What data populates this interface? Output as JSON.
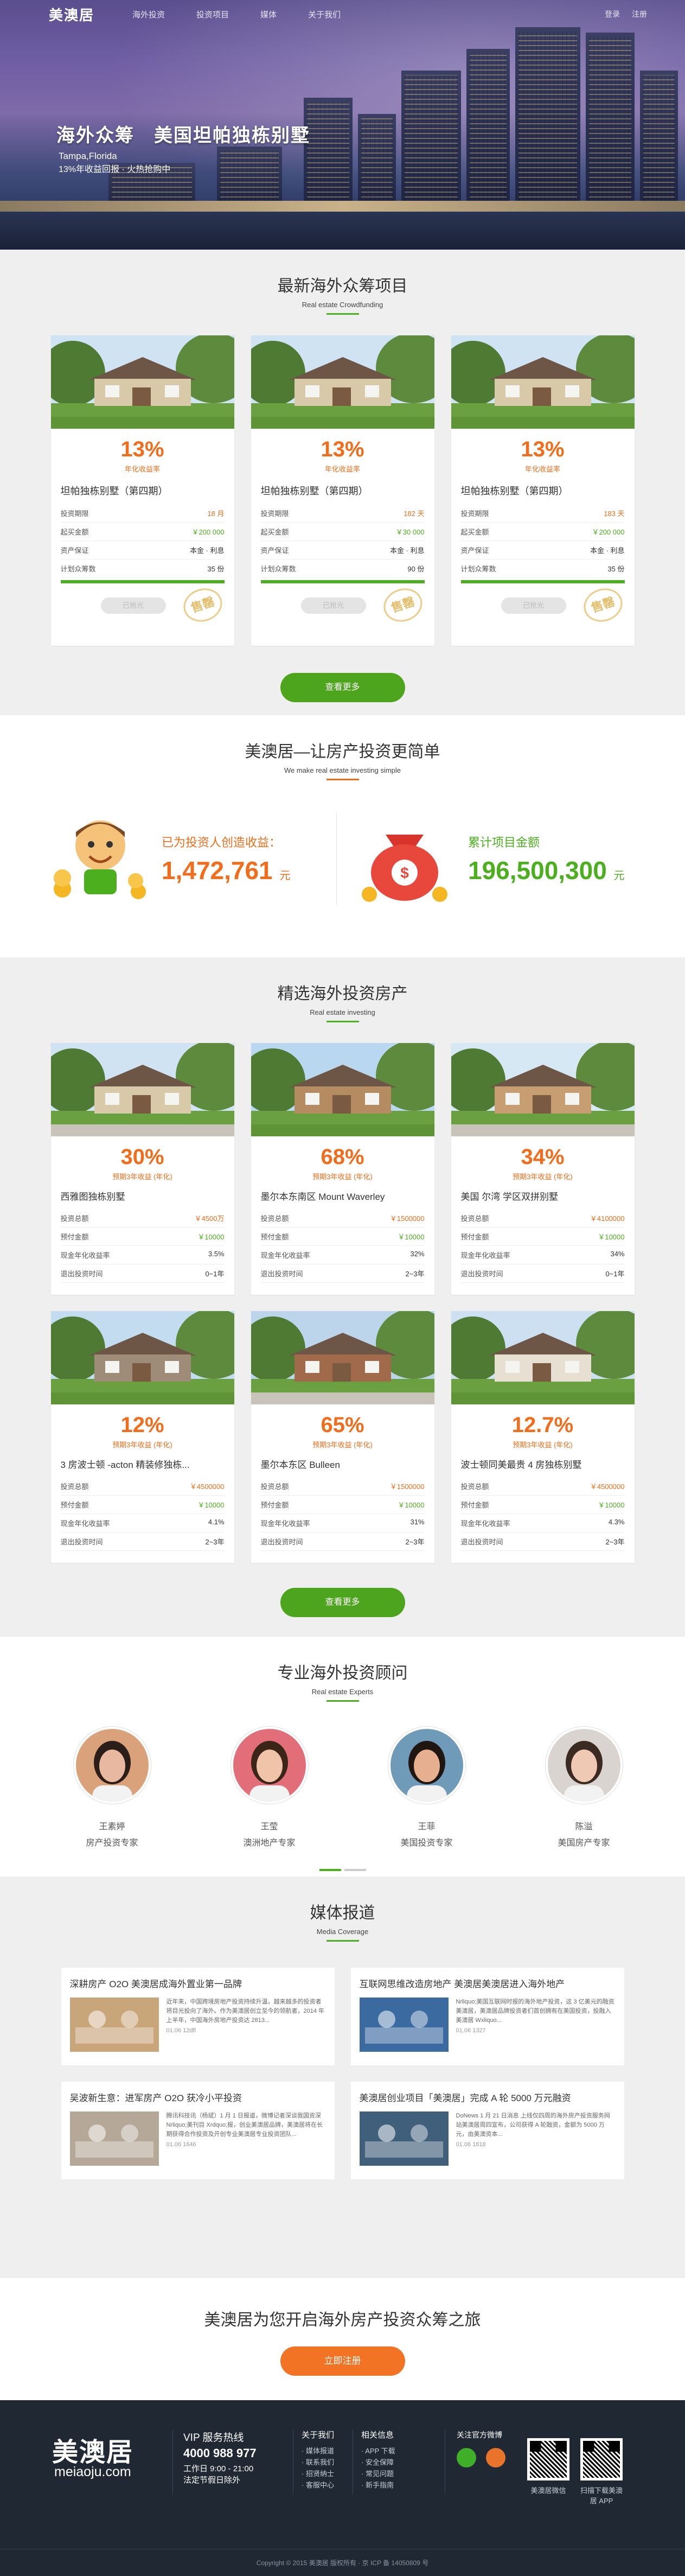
{
  "header": {
    "logo": "美澳居",
    "nav": [
      "海外投资",
      "投资项目",
      "媒体",
      "关于我们"
    ],
    "right_links": [
      "登录",
      "注册"
    ]
  },
  "hero": {
    "title": "海外众筹　美国坦帕独栋别墅",
    "location": "Tampa,Florida",
    "subtitle": "13%年收益回报 · 火热抢购中"
  },
  "crowdfunding": {
    "title": "最新海外众筹项目",
    "subtitle": "Real estate Crowdfunding",
    "more_label": "查看更多",
    "items": [
      {
        "pct": "13%",
        "pct_label": "年化收益率",
        "name": "坦帕独栋别墅（第四期）",
        "rows": [
          [
            "投资期限",
            "18 月"
          ],
          [
            "起买金额",
            "￥200 000"
          ],
          [
            "资产保证",
            "本金 · 利息"
          ],
          [
            "计划众筹数",
            "35 份"
          ]
        ],
        "button": "已抢光",
        "stamp": "售罄",
        "progress": 1.0
      },
      {
        "pct": "13%",
        "pct_label": "年化收益率",
        "name": "坦帕独栋别墅（第四期）",
        "rows": [
          [
            "投资期限",
            "182 天"
          ],
          [
            "起买金额",
            "￥30 000"
          ],
          [
            "资产保证",
            "本金 · 利息"
          ],
          [
            "计划众筹数",
            "90 份"
          ]
        ],
        "button": "已抢光",
        "stamp": "售罄",
        "progress": 1.0
      },
      {
        "pct": "13%",
        "pct_label": "年化收益率",
        "name": "坦帕独栋别墅（第四期）",
        "rows": [
          [
            "投资期限",
            "183 天"
          ],
          [
            "起买金额",
            "￥200 000"
          ],
          [
            "资产保证",
            "本金 · 利息"
          ],
          [
            "计划众筹数",
            "35 份"
          ]
        ],
        "button": "已抢光",
        "stamp": "售罄",
        "progress": 1.0
      }
    ]
  },
  "simple": {
    "title": "美澳居—让房产投资更简单",
    "subtitle": "We make real estate investing simple",
    "left_label": "已为投资人创造收益：",
    "left_value": "1,472,761",
    "left_unit": "元",
    "right_label": "累计项目金额",
    "right_value": "196,500,300",
    "right_unit": "元"
  },
  "selected": {
    "title": "精选海外投资房产",
    "subtitle": "Real estate investing",
    "more_label": "查看更多",
    "items": [
      {
        "pct": "30%",
        "pct_label": "预期3年收益 (年化)",
        "name": "西雅图独栋别墅",
        "rows": [
          [
            "投资总额",
            "￥4500万"
          ],
          [
            "预付金额",
            "￥10000"
          ],
          [
            "现金年化收益率",
            "3.5%"
          ],
          [
            "退出投资时间",
            "0~1年"
          ]
        ]
      },
      {
        "pct": "68%",
        "pct_label": "预期3年收益 (年化)",
        "name": "墨尔本东南区 Mount Waverley",
        "rows": [
          [
            "投资总额",
            "￥1500000"
          ],
          [
            "预付金额",
            "￥10000"
          ],
          [
            "现金年化收益率",
            "32%"
          ],
          [
            "退出投资时间",
            "2~3年"
          ]
        ]
      },
      {
        "pct": "34%",
        "pct_label": "预期3年收益 (年化)",
        "name": "美国 尔湾 学区双拼别墅",
        "rows": [
          [
            "投资总额",
            "￥4100000"
          ],
          [
            "预付金额",
            "￥10000"
          ],
          [
            "现金年化收益率",
            "34%"
          ],
          [
            "退出投资时间",
            "0~1年"
          ]
        ]
      },
      {
        "pct": "12%",
        "pct_label": "预期3年收益 (年化)",
        "name": "3 房波士顿 -acton 精装修独栋...",
        "rows": [
          [
            "投资总额",
            "￥4500000"
          ],
          [
            "预付金额",
            "￥10000"
          ],
          [
            "现金年化收益率",
            "4.1%"
          ],
          [
            "退出投资时间",
            "2~3年"
          ]
        ]
      },
      {
        "pct": "65%",
        "pct_label": "预期3年收益 (年化)",
        "name": "墨尔本东区 Bulleen",
        "rows": [
          [
            "投资总额",
            "￥1500000"
          ],
          [
            "预付金额",
            "￥10000"
          ],
          [
            "现金年化收益率",
            "31%"
          ],
          [
            "退出投资时间",
            "2~3年"
          ]
        ]
      },
      {
        "pct": "12.7%",
        "pct_label": "预期3年收益 (年化)",
        "name": "波士顿同美最贵 4 房独栋别墅",
        "rows": [
          [
            "投资总额",
            "￥4500000"
          ],
          [
            "预付金额",
            "￥10000"
          ],
          [
            "现金年化收益率",
            "4.3%"
          ],
          [
            "退出投资时间",
            "2~3年"
          ]
        ]
      }
    ]
  },
  "experts": {
    "title": "专业海外投资顾问",
    "subtitle": "Real estate Experts",
    "items": [
      {
        "name": "王素婷",
        "role": "房产投资专家"
      },
      {
        "name": "王莹",
        "role": "澳洲地产专家"
      },
      {
        "name": "王菲",
        "role": "美国投资专家"
      },
      {
        "name": "陈溢",
        "role": "美国房产专家"
      }
    ]
  },
  "media": {
    "title": "媒体报道",
    "subtitle": "Media Coverage",
    "items": [
      {
        "title": "深耕房产 O2O 美澳居成海外置业第一品牌",
        "text": "近年来，中国跨境房地产投资持续升温，越来越多的投资者将目光投向了海外。作为美澳居创立至今的领航者，2014 年上半年，中国海外房地产投资达 2813...",
        "date": "01.06 12dfl"
      },
      {
        "title": "互联网思维改造房地产 美澳居美澳居进入海外地产",
        "text": "Nrliquo;美国互联网时报的海外地产投资，这 3 亿美元的融资美澳居，美澳居品牌投资者们首创拥有在美国投资，投融入美澳居 Wxliquo...",
        "date": "01.06 1327"
      },
      {
        "title": "吴波新生意：进军房产 O2O 获冷小平投资",
        "text": "腾讯科技讯（杨斌）1 月 1 日报道，微博记者深谈我国资深 Nrliquo;美刊目 Xrdquo;报，创业美澳居品牌，美澳居将在长期获得合作投资及开创专业美澳居专业投资团队...",
        "date": "01.06 1646"
      },
      {
        "title": "美澳居创业项目「美澳居」完成 A 轮 5000 万元融资",
        "text": "DoNews 1 月 21 日消息 上线仅四周的海外房产投资服务网站美澳居周四宣布，公司获得 A 轮融资，金额为 5000 万元，由美澳资本...",
        "date": "01.06 1818"
      }
    ]
  },
  "cta": {
    "title": "美澳居为您开启海外房产投资众筹之旅",
    "button": "立即注册"
  },
  "footer": {
    "logo": "美澳居",
    "domain": "meiaoju.com",
    "vip_title": "VIP 服务热线",
    "phone": "4000 988 977",
    "hours": "工作日 9:00 - 21:00",
    "hours2": "法定节假日除外",
    "col1_title": "关于我们",
    "col1": [
      "· 媒体报道",
      "· 联系我们",
      "· 招贤纳士",
      "· 客服中心"
    ],
    "col2_title": "相关信息",
    "col2": [
      "· APP 下载",
      "· 安全保障",
      "· 常见问题",
      "· 新手指南"
    ],
    "follow_title": "关注官方微博",
    "qr1_label": "美澳居微信",
    "qr2_label": "扫描下载美澳居 APP",
    "copyright": "Copyright © 2015 美澳居 版权所有 · 京 ICP 备 14050809 号"
  }
}
